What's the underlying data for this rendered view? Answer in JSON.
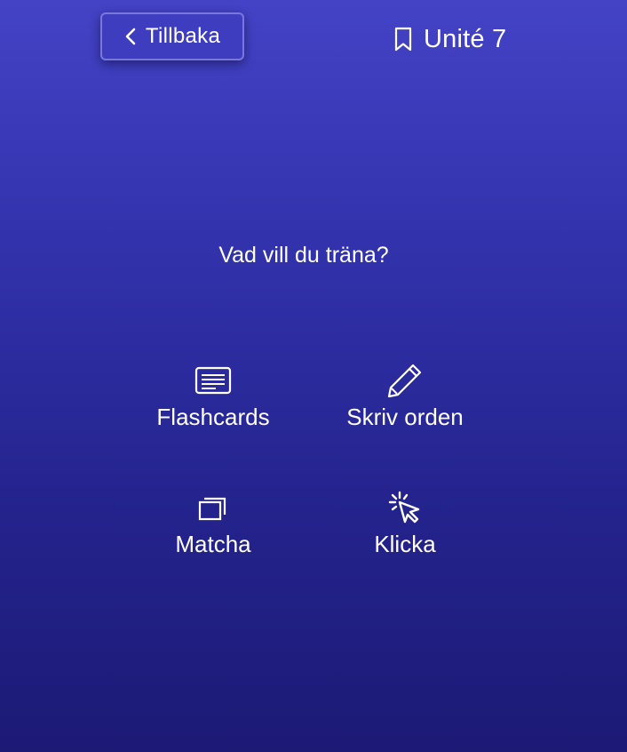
{
  "header": {
    "back_label": "Tillbaka",
    "back_icon": "chevron-left-icon",
    "unit_title": "Unité 7",
    "unit_icon": "bookmark-icon"
  },
  "main": {
    "prompt": "Vad vill du träna?",
    "modes": [
      {
        "label": "Flashcards",
        "icon": "flashcard-icon"
      },
      {
        "label": "Skriv orden",
        "icon": "pencil-icon"
      },
      {
        "label": "Matcha",
        "icon": "stacked-cards-icon"
      },
      {
        "label": "Klicka",
        "icon": "cursor-click-icon"
      }
    ]
  },
  "colors": {
    "background_top": "#4443c6",
    "background_bottom": "#1c1a75",
    "text": "#ffffff"
  }
}
